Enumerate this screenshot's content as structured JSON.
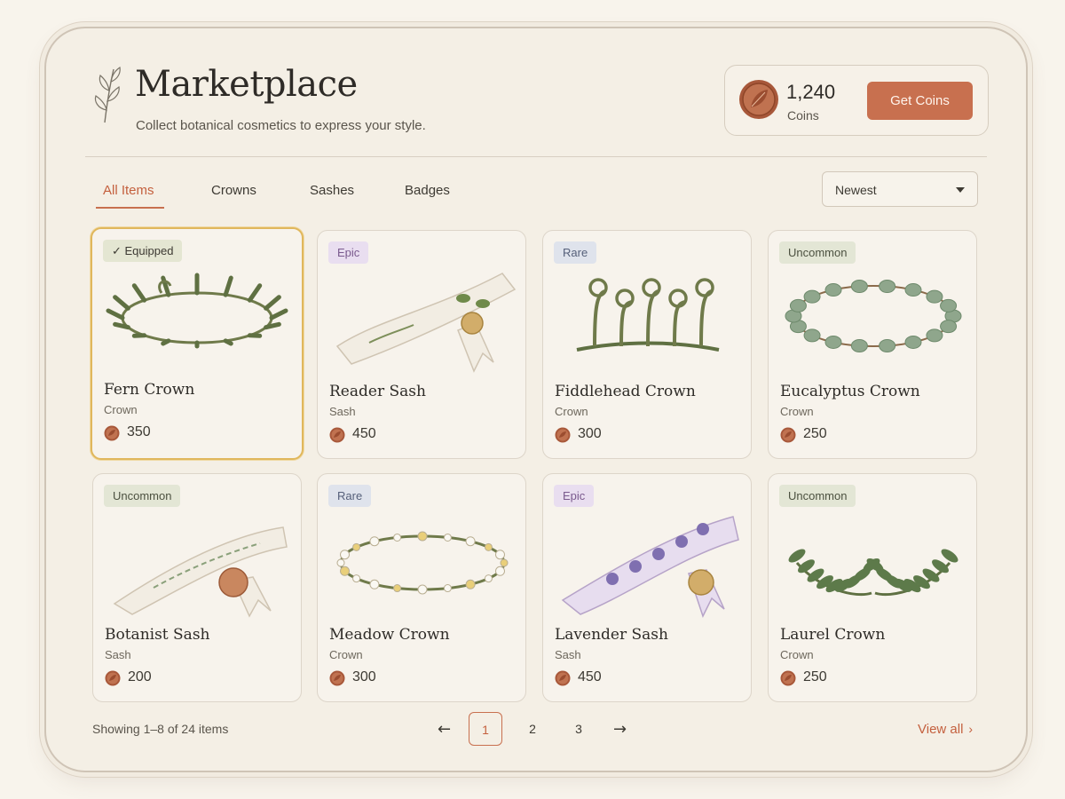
{
  "header": {
    "title": "Marketplace",
    "subtitle": "Collect botanical cosmetics to express your style.",
    "logo_icon": "leaf-sprig-icon"
  },
  "wallet": {
    "amount": "1,240",
    "label": "Coins",
    "button": "Get Coins",
    "icon": "leaf-coin-icon"
  },
  "tabs": [
    {
      "label": "All Items",
      "active": true
    },
    {
      "label": "Crowns",
      "active": false
    },
    {
      "label": "Sashes",
      "active": false
    },
    {
      "label": "Badges",
      "active": false
    }
  ],
  "sort": {
    "value": "Newest"
  },
  "items": [
    {
      "badge": "✓ Equipped",
      "badge_type": "Equipped",
      "name": "Fern Crown",
      "type": "Crown",
      "price": "350",
      "art": "fern-crown"
    },
    {
      "badge": "Epic",
      "badge_type": "Epic",
      "name": "Reader Sash",
      "type": "Sash",
      "price": "450",
      "art": "reader-sash"
    },
    {
      "badge": "Rare",
      "badge_type": "Rare",
      "name": "Fiddlehead Crown",
      "type": "Crown",
      "price": "300",
      "art": "fiddlehead-crown"
    },
    {
      "badge": "Uncommon",
      "badge_type": "Uncommon",
      "name": "Eucalyptus Crown",
      "type": "Crown",
      "price": "250",
      "art": "eucalyptus-crown"
    },
    {
      "badge": "Uncommon",
      "badge_type": "Uncommon",
      "name": "Botanist Sash",
      "type": "Sash",
      "price": "200",
      "art": "botanist-sash"
    },
    {
      "badge": "Rare",
      "badge_type": "Rare",
      "name": "Meadow Crown",
      "type": "Crown",
      "price": "300",
      "art": "meadow-crown"
    },
    {
      "badge": "Epic",
      "badge_type": "Epic",
      "name": "Lavender Sash",
      "type": "Sash",
      "price": "450",
      "art": "lavender-sash"
    },
    {
      "badge": "Uncommon",
      "badge_type": "Uncommon",
      "name": "Laurel Crown",
      "type": "Crown",
      "price": "250",
      "art": "laurel-crown"
    }
  ],
  "footer": {
    "showing": "Showing 1–8 of 24 items",
    "pages": [
      "1",
      "2",
      "3"
    ],
    "current_page": "1",
    "prev_icon": "arrow-left-icon",
    "next_icon": "arrow-right-icon",
    "view_all": "View all"
  },
  "colors": {
    "accent": "#c8704f",
    "background": "#f4efe5",
    "equipped_border": "#e0b75c"
  }
}
